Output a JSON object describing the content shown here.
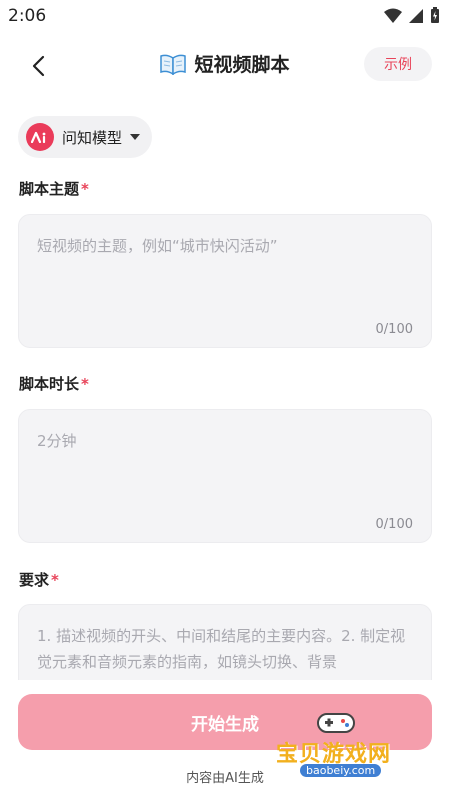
{
  "status_bar": {
    "time": "2:06"
  },
  "header": {
    "title": "短视频脚本",
    "example_label": "示例"
  },
  "model": {
    "label": "问知模型"
  },
  "fields": {
    "topic": {
      "label": "脚本主题",
      "required_mark": "*",
      "placeholder": "短视频的主题，例如“城市快闪活动”",
      "counter": "0/100"
    },
    "duration": {
      "label": "脚本时长",
      "required_mark": "*",
      "placeholder": "2分钟",
      "counter": "0/100"
    },
    "requirements": {
      "label": "要求",
      "required_mark": "*",
      "placeholder": "1. 描述视频的开头、中间和结尾的主要内容。2. 制定视觉元素和音频元素的指南，如镜头切换、背景"
    }
  },
  "footer": {
    "generate_label": "开始生成",
    "note": "内容由AI生成"
  },
  "watermark": {
    "text": "宝贝游戏网",
    "url": "baobeiy.com"
  },
  "colors": {
    "accent": "#e8445a",
    "button_disabled": "#f59eac",
    "field_bg": "#f4f4f6"
  }
}
